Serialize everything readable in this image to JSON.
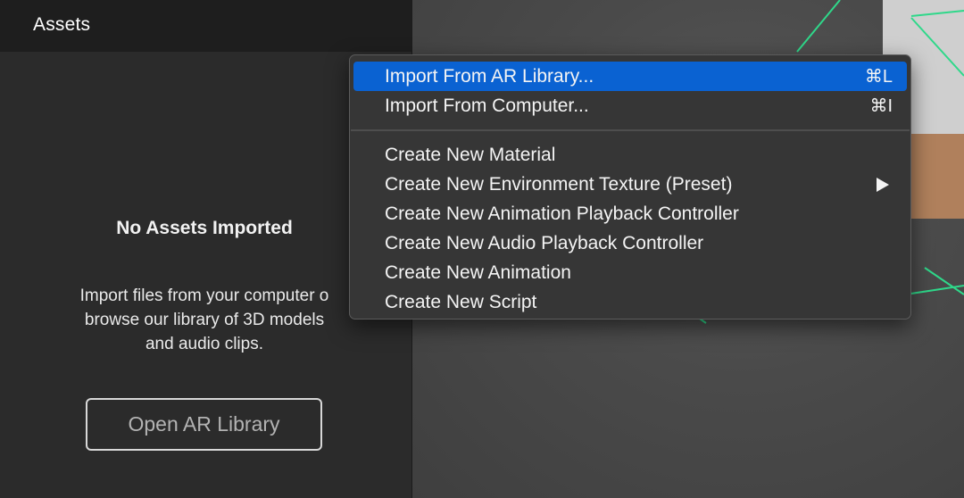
{
  "assets_panel": {
    "title": "Assets",
    "empty_title": "No Assets Imported",
    "empty_description": "Import files from your computer o\nbrowse our library of 3D models\nand audio clips.",
    "open_library_label": "Open AR Library"
  },
  "context_menu": {
    "items": [
      {
        "label": "Import From AR Library...",
        "shortcut": "⌘L",
        "highlighted": true
      },
      {
        "label": "Import From Computer...",
        "shortcut": "⌘I"
      },
      {
        "label": "Create New Material"
      },
      {
        "label": "Create New Environment Texture (Preset)",
        "submenu_icon": "submenu-arrow-icon"
      },
      {
        "label": "Create New Animation Playback Controller"
      },
      {
        "label": "Create New Audio Playback Controller"
      },
      {
        "label": "Create New Animation"
      },
      {
        "label": "Create New Script"
      }
    ],
    "colors": {
      "highlight": "#0a62d2",
      "background": "#363636"
    }
  },
  "viewport": {
    "colors": {
      "guide_lines": "#2fd88a",
      "background": "#4a4a4a"
    }
  }
}
